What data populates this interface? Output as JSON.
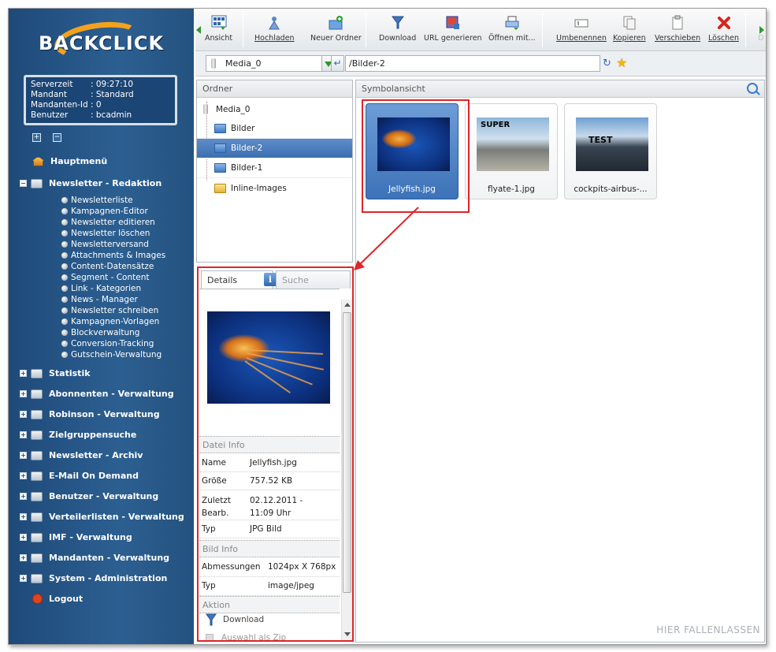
{
  "sidebar": {
    "logo": "BACKCLICK",
    "info": [
      {
        "key": "Serverzeit",
        "value": ": 09:27:10"
      },
      {
        "key": "Mandant",
        "value": ": Standard"
      },
      {
        "key": "Mandanten-Id",
        "value": ": 0"
      },
      {
        "key": "Benutzer",
        "value": ": bcadmin"
      }
    ],
    "expand_all": "+",
    "collapse_all": "−",
    "main_menu": "Hauptmenü",
    "newsletter_section": "Newsletter - Redaktion",
    "newsletter_items": [
      "Newsletterliste",
      "Kampagnen-Editor",
      "Newsletter editieren",
      "Newsletter löschen",
      "Newsletterversand",
      "Attachments & Images",
      "Content-Datensätze",
      "Segment - Content",
      "Link - Kategorien",
      "News - Manager",
      "Newsletter schreiben",
      "Kampagnen-Vorlagen",
      "Blockverwaltung",
      "Conversion-Tracking",
      "Gutschein-Verwaltung"
    ],
    "sections": [
      "Statistik",
      "Abonnenten - Verwaltung",
      "Robinson - Verwaltung",
      "Zielgruppensuche",
      "Newsletter - Archiv",
      "E-Mail On Demand",
      "Benutzer - Verwaltung",
      "Verteilerlisten - Verwaltung",
      "IMF - Verwaltung",
      "Mandanten - Verwaltung",
      "System - Administration"
    ],
    "logout": "Logout"
  },
  "toolbar": {
    "view": "Ansicht",
    "upload": "Hochladen",
    "new_folder": "Neuer Ordner",
    "download": "Download",
    "url": "URL generieren",
    "open_with": "Öffnen mit...",
    "rename": "Umbenennen",
    "copy": "Kopieren",
    "move": "Verschieben",
    "delete": "Löschen",
    "cut_off": "D"
  },
  "address": {
    "media": "Media_0",
    "path": "/Bilder-2"
  },
  "folders": {
    "title": "Ordner",
    "root": "Media_0",
    "items": [
      "Bilder",
      "Bilder-2",
      "Bilder-1",
      "Inline-Images"
    ]
  },
  "details": {
    "tab_details": "Details",
    "tab_search": "Suche",
    "info_badge": "i",
    "file_info_title": "Datei Info",
    "name_label": "Name",
    "name_value": "Jellyfish.jpg",
    "size_label": "Größe",
    "size_value": "757.52 KB",
    "modified_label": "Zuletzt Bearb.",
    "modified_value": "02.12.2011 - 11:09 Uhr",
    "type_label": "Typ",
    "type_value": "JPG Bild",
    "image_info_title": "Bild Info",
    "dims_label": "Abmessungen",
    "dims_value": "1024px X 768px",
    "mime_label": "Typ",
    "mime_value": "image/jpeg",
    "action_title": "Aktion",
    "action_download": "Download",
    "action_zip": "Auswahl als Zip"
  },
  "icons_view": {
    "title": "Symbolansicht",
    "files": [
      {
        "name": "Jellyfish.jpg",
        "overlay": ""
      },
      {
        "name": "flyate-1.jpg",
        "overlay": "SUPER"
      },
      {
        "name": "cockpits-airbus-...",
        "overlay": "TEST"
      }
    ],
    "drop_hint": "HIER FALLENLASSEN"
  },
  "colors": {
    "sidebar": "#24527f",
    "selection": "#3c6fb1",
    "highlight": "#e0242a"
  }
}
